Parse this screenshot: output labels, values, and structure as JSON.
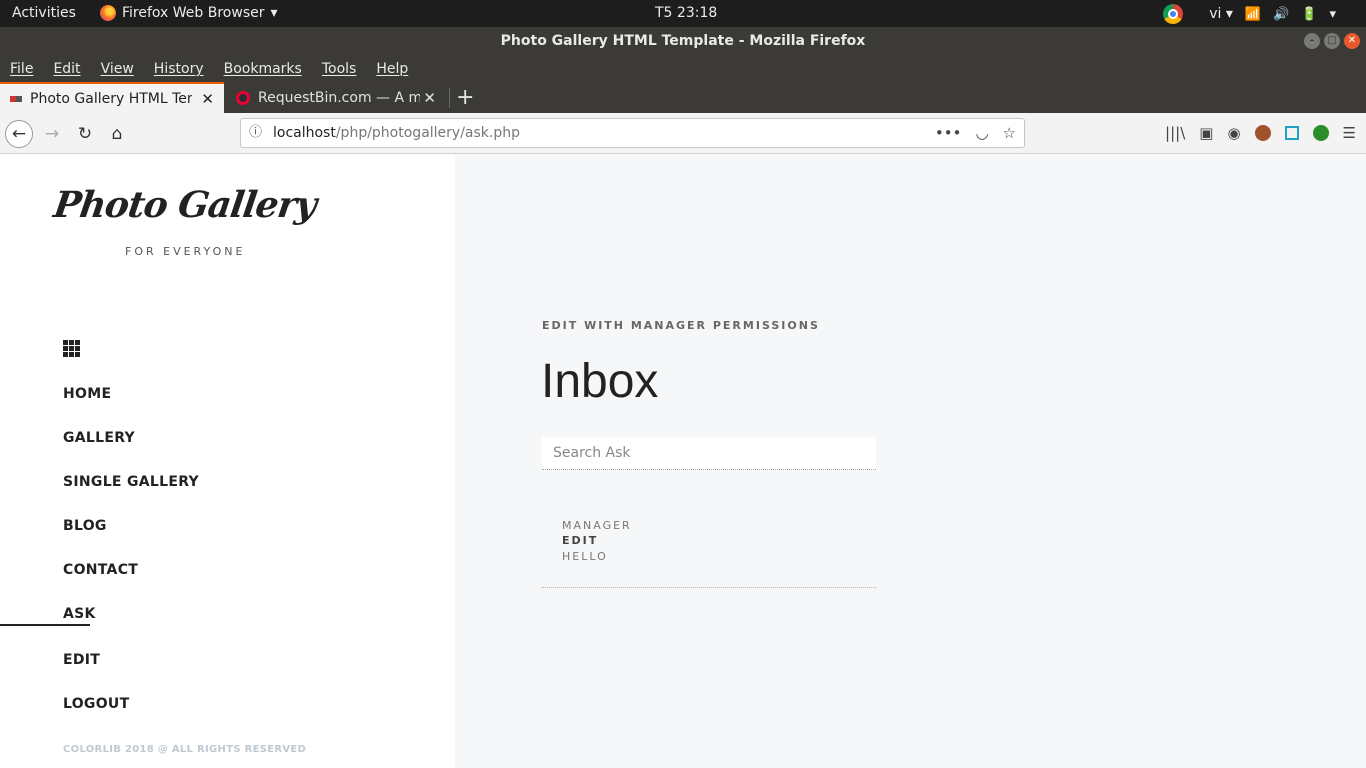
{
  "system_bar": {
    "activities": "Activities",
    "app_name": "Firefox Web Browser",
    "clock": "T5 23:18",
    "language": "vi"
  },
  "window": {
    "title": "Photo Gallery HTML Template - Mozilla Firefox"
  },
  "menu": [
    "File",
    "Edit",
    "View",
    "History",
    "Bookmarks",
    "Tools",
    "Help"
  ],
  "tabs": [
    {
      "label": "Photo Gallery HTML Tem",
      "active": true
    },
    {
      "label": "RequestBin.com — A mo",
      "active": false
    }
  ],
  "url": {
    "host": "localhost",
    "path": "/php/photogallery/ask.php"
  },
  "sidebar": {
    "logo": "Photo Gallery",
    "tagline": "FOR EVERYONE",
    "nav": [
      "HOME",
      "GALLERY",
      "SINGLE GALLERY",
      "BLOG",
      "CONTACT",
      "ASK",
      "EDIT",
      "LOGOUT"
    ],
    "active_item": "ASK",
    "copyright": "COLORLIB 2018 @ ALL RIGHTS RESERVED"
  },
  "main": {
    "eyebrow": "EDIT WITH MANAGER PERMISSIONS",
    "title": "Inbox",
    "search_placeholder": "Search Ask",
    "message": {
      "from": "MANAGER",
      "action": "EDIT",
      "text": "HELLO"
    }
  },
  "colors": {
    "accent_tab": "#e66000",
    "page_bg": "#f6f7f9",
    "sidebar_bg": "#ffffff",
    "text": "#222222"
  }
}
